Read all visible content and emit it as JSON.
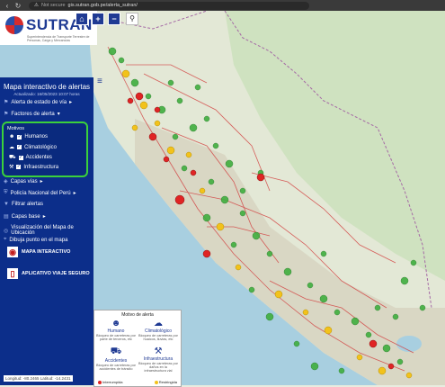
{
  "browser": {
    "security": "Not secure",
    "url": "gis.sutran.gob.pe/alerta_sutran/"
  },
  "header": {
    "logo": "SUTRAN",
    "subtitle": "Superintendencia de Transporte Terrestre de Personas, Carga y Mercancías",
    "search_icon": "search-icon"
  },
  "panel": {
    "title": "Mapa interactivo de alertas",
    "updated": "Actualizado: 16/05/2023 10:07 horas",
    "items": [
      {
        "label": "Alerta de estado de vía",
        "icon": "caret-right-icon"
      },
      {
        "label": "Factores de alerta",
        "icon": "caret-right-icon"
      }
    ],
    "motivos_label": "Motivos",
    "motivos": [
      {
        "label": "Humanos",
        "icon": "person-icon"
      },
      {
        "label": "Climatológico",
        "icon": "cloud-icon"
      },
      {
        "label": "Accidentes",
        "icon": "car-crash-icon"
      },
      {
        "label": "Infraestructura",
        "icon": "road-icon"
      }
    ],
    "layers": [
      {
        "label": "Capas vías",
        "icon": "layers-icon"
      },
      {
        "label": "Policía Nacional del Perú",
        "icon": "shield-icon"
      },
      {
        "label": "Filtrar alertas",
        "icon": "filter-icon"
      },
      {
        "label": "Capas base",
        "icon": "map-icon"
      },
      {
        "label": "Visualización del Mapa de Ubicación",
        "icon": "target-icon"
      },
      {
        "label": "Dibuja punto en el mapa",
        "icon": "pin-icon"
      }
    ],
    "apps": [
      {
        "label": "MAPA INTERACTIVO",
        "icon": "map-app-icon"
      },
      {
        "label": "APLICATIVO VIAJE SEGURO",
        "icon": "phone-app-icon"
      }
    ]
  },
  "coords": "Longitud: -80.2465 Latitud: -14.2431",
  "legend": {
    "title": "Motivo de alerta",
    "cells": [
      {
        "name": "Humano",
        "desc": "Bloqueo de carreteras por parte de terceros, etc"
      },
      {
        "name": "Climatológico",
        "desc": "Bloqueo de carreteras por huaicos, lluvias, etc"
      },
      {
        "name": "Accidentes",
        "desc": "Bloqueo de carreteras por accidentes de tránsito"
      },
      {
        "name": "Infraestructura",
        "desc": "Bloqueo de carreteras por daños en la infraestructura vial"
      }
    ],
    "status": [
      {
        "label": "Interrumpida",
        "color": "#e02424"
      },
      {
        "label": "Restringida",
        "color": "#f2c21b"
      }
    ]
  },
  "colors": {
    "normal": "#3fae3f",
    "restringida": "#f2c21b",
    "interrumpida": "#e02424",
    "sidebar": "#0c2e8a"
  }
}
